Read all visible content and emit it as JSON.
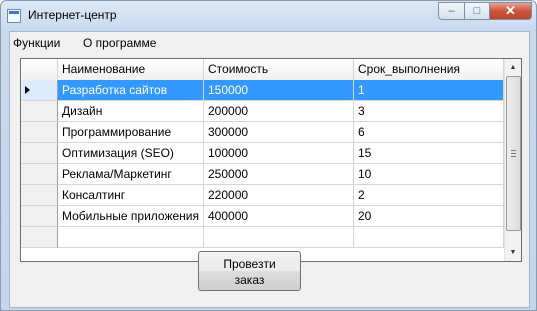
{
  "window": {
    "title": "Интернет-центр",
    "controls": {
      "minimize": "–",
      "maximize": "□",
      "close": "✕"
    }
  },
  "menu": {
    "items": [
      "Функции",
      "О программе"
    ]
  },
  "grid": {
    "columns": [
      "Наименование",
      "Стоимость",
      "Срок_выполнения"
    ],
    "rows": [
      [
        "Разработка сайтов",
        "150000",
        "1"
      ],
      [
        "Дизайн",
        "200000",
        "3"
      ],
      [
        "Программирование",
        "300000",
        "6"
      ],
      [
        "Оптимизация (SEO)",
        "100000",
        "15"
      ],
      [
        "Реклама/Маркетинг",
        "250000",
        "10"
      ],
      [
        "Консалтинг",
        "220000",
        "2"
      ],
      [
        "Мобильные приложения",
        "400000",
        "20"
      ]
    ],
    "selected_row": 0
  },
  "order_button": {
    "label_line1": "Провезти",
    "label_line2": "заказ"
  },
  "colors": {
    "selection": "#3399ff",
    "titlebar": "#c9daee",
    "close_button": "#c9543c"
  },
  "icons": {
    "app": "app-icon",
    "current_row": "triangle-right-icon",
    "scroll_up": "chevron-up-icon",
    "scroll_down": "chevron-down-icon"
  }
}
